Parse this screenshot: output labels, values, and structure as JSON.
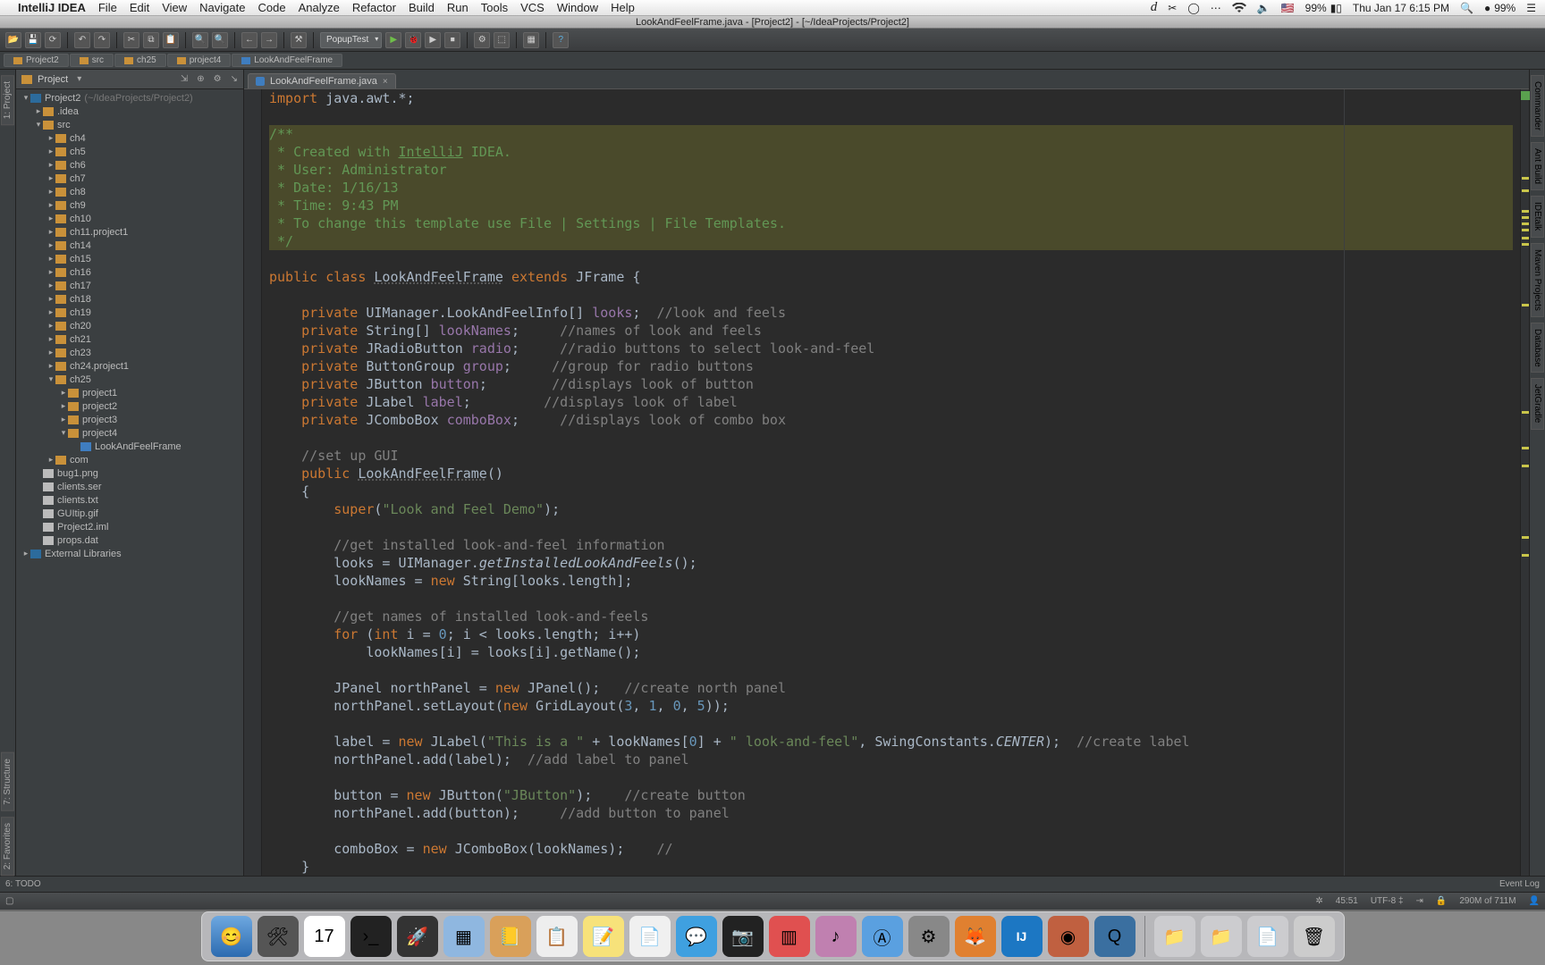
{
  "mac_menu": {
    "app": "IntelliJ IDEA",
    "items": [
      "File",
      "Edit",
      "View",
      "Navigate",
      "Code",
      "Analyze",
      "Refactor",
      "Build",
      "Run",
      "Tools",
      "VCS",
      "Window",
      "Help"
    ],
    "right": {
      "battery": "99%",
      "time": "Thu Jan 17  6:15 PM",
      "batt2": "99%"
    }
  },
  "window_title": "LookAndFeelFrame.java - [Project2] - [~/IdeaProjects/Project2]",
  "toolbar_combo": "PopupTest",
  "nav": [
    "Project2",
    "src",
    "ch25",
    "project4",
    "LookAndFeelFrame"
  ],
  "project_panel": {
    "title": "Project"
  },
  "tree": [
    {
      "d": 0,
      "c": "open",
      "i": "module",
      "l": "Project2",
      "e": "(~/IdeaProjects/Project2)"
    },
    {
      "d": 1,
      "c": "closed",
      "i": "folder",
      "l": ".idea"
    },
    {
      "d": 1,
      "c": "open",
      "i": "folder",
      "l": "src"
    },
    {
      "d": 2,
      "c": "closed",
      "i": "folder",
      "l": "ch4"
    },
    {
      "d": 2,
      "c": "closed",
      "i": "folder",
      "l": "ch5"
    },
    {
      "d": 2,
      "c": "closed",
      "i": "folder",
      "l": "ch6"
    },
    {
      "d": 2,
      "c": "closed",
      "i": "folder",
      "l": "ch7"
    },
    {
      "d": 2,
      "c": "closed",
      "i": "folder",
      "l": "ch8"
    },
    {
      "d": 2,
      "c": "closed",
      "i": "folder",
      "l": "ch9"
    },
    {
      "d": 2,
      "c": "closed",
      "i": "folder",
      "l": "ch10"
    },
    {
      "d": 2,
      "c": "closed",
      "i": "folder",
      "l": "ch11.project1"
    },
    {
      "d": 2,
      "c": "closed",
      "i": "folder",
      "l": "ch14"
    },
    {
      "d": 2,
      "c": "closed",
      "i": "folder",
      "l": "ch15"
    },
    {
      "d": 2,
      "c": "closed",
      "i": "folder",
      "l": "ch16"
    },
    {
      "d": 2,
      "c": "closed",
      "i": "folder",
      "l": "ch17"
    },
    {
      "d": 2,
      "c": "closed",
      "i": "folder",
      "l": "ch18"
    },
    {
      "d": 2,
      "c": "closed",
      "i": "folder",
      "l": "ch19"
    },
    {
      "d": 2,
      "c": "closed",
      "i": "folder",
      "l": "ch20"
    },
    {
      "d": 2,
      "c": "closed",
      "i": "folder",
      "l": "ch21"
    },
    {
      "d": 2,
      "c": "closed",
      "i": "folder",
      "l": "ch23"
    },
    {
      "d": 2,
      "c": "closed",
      "i": "folder",
      "l": "ch24.project1"
    },
    {
      "d": 2,
      "c": "open",
      "i": "folder",
      "l": "ch25"
    },
    {
      "d": 3,
      "c": "closed",
      "i": "folder",
      "l": "project1"
    },
    {
      "d": 3,
      "c": "closed",
      "i": "folder",
      "l": "project2"
    },
    {
      "d": 3,
      "c": "closed",
      "i": "folder",
      "l": "project3"
    },
    {
      "d": 3,
      "c": "open",
      "i": "folder",
      "l": "project4"
    },
    {
      "d": 4,
      "c": "none",
      "i": "java",
      "l": "LookAndFeelFrame"
    },
    {
      "d": 2,
      "c": "closed",
      "i": "folder",
      "l": "com"
    },
    {
      "d": 1,
      "c": "none",
      "i": "file",
      "l": "bug1.png"
    },
    {
      "d": 1,
      "c": "none",
      "i": "file",
      "l": "clients.ser"
    },
    {
      "d": 1,
      "c": "none",
      "i": "file",
      "l": "clients.txt"
    },
    {
      "d": 1,
      "c": "none",
      "i": "file",
      "l": "GUItip.gif"
    },
    {
      "d": 1,
      "c": "none",
      "i": "file",
      "l": "Project2.iml"
    },
    {
      "d": 1,
      "c": "none",
      "i": "file",
      "l": "props.dat"
    },
    {
      "d": 0,
      "c": "closed",
      "i": "module",
      "l": "External Libraries"
    }
  ],
  "tab": "LookAndFeelFrame.java",
  "status": {
    "pos": "45:51",
    "enc": "UTF-8",
    "mem": "290M of 711M"
  },
  "bottom": {
    "todo": "6: TODO",
    "eventlog": "Event Log"
  },
  "left_tabs": [
    "1: Project",
    "7: Structure",
    "2: Favorites"
  ],
  "right_tabs": [
    "Commander",
    "Ant Build",
    "IDEtalk",
    "Maven Projects",
    "Database",
    "JetGradle"
  ]
}
